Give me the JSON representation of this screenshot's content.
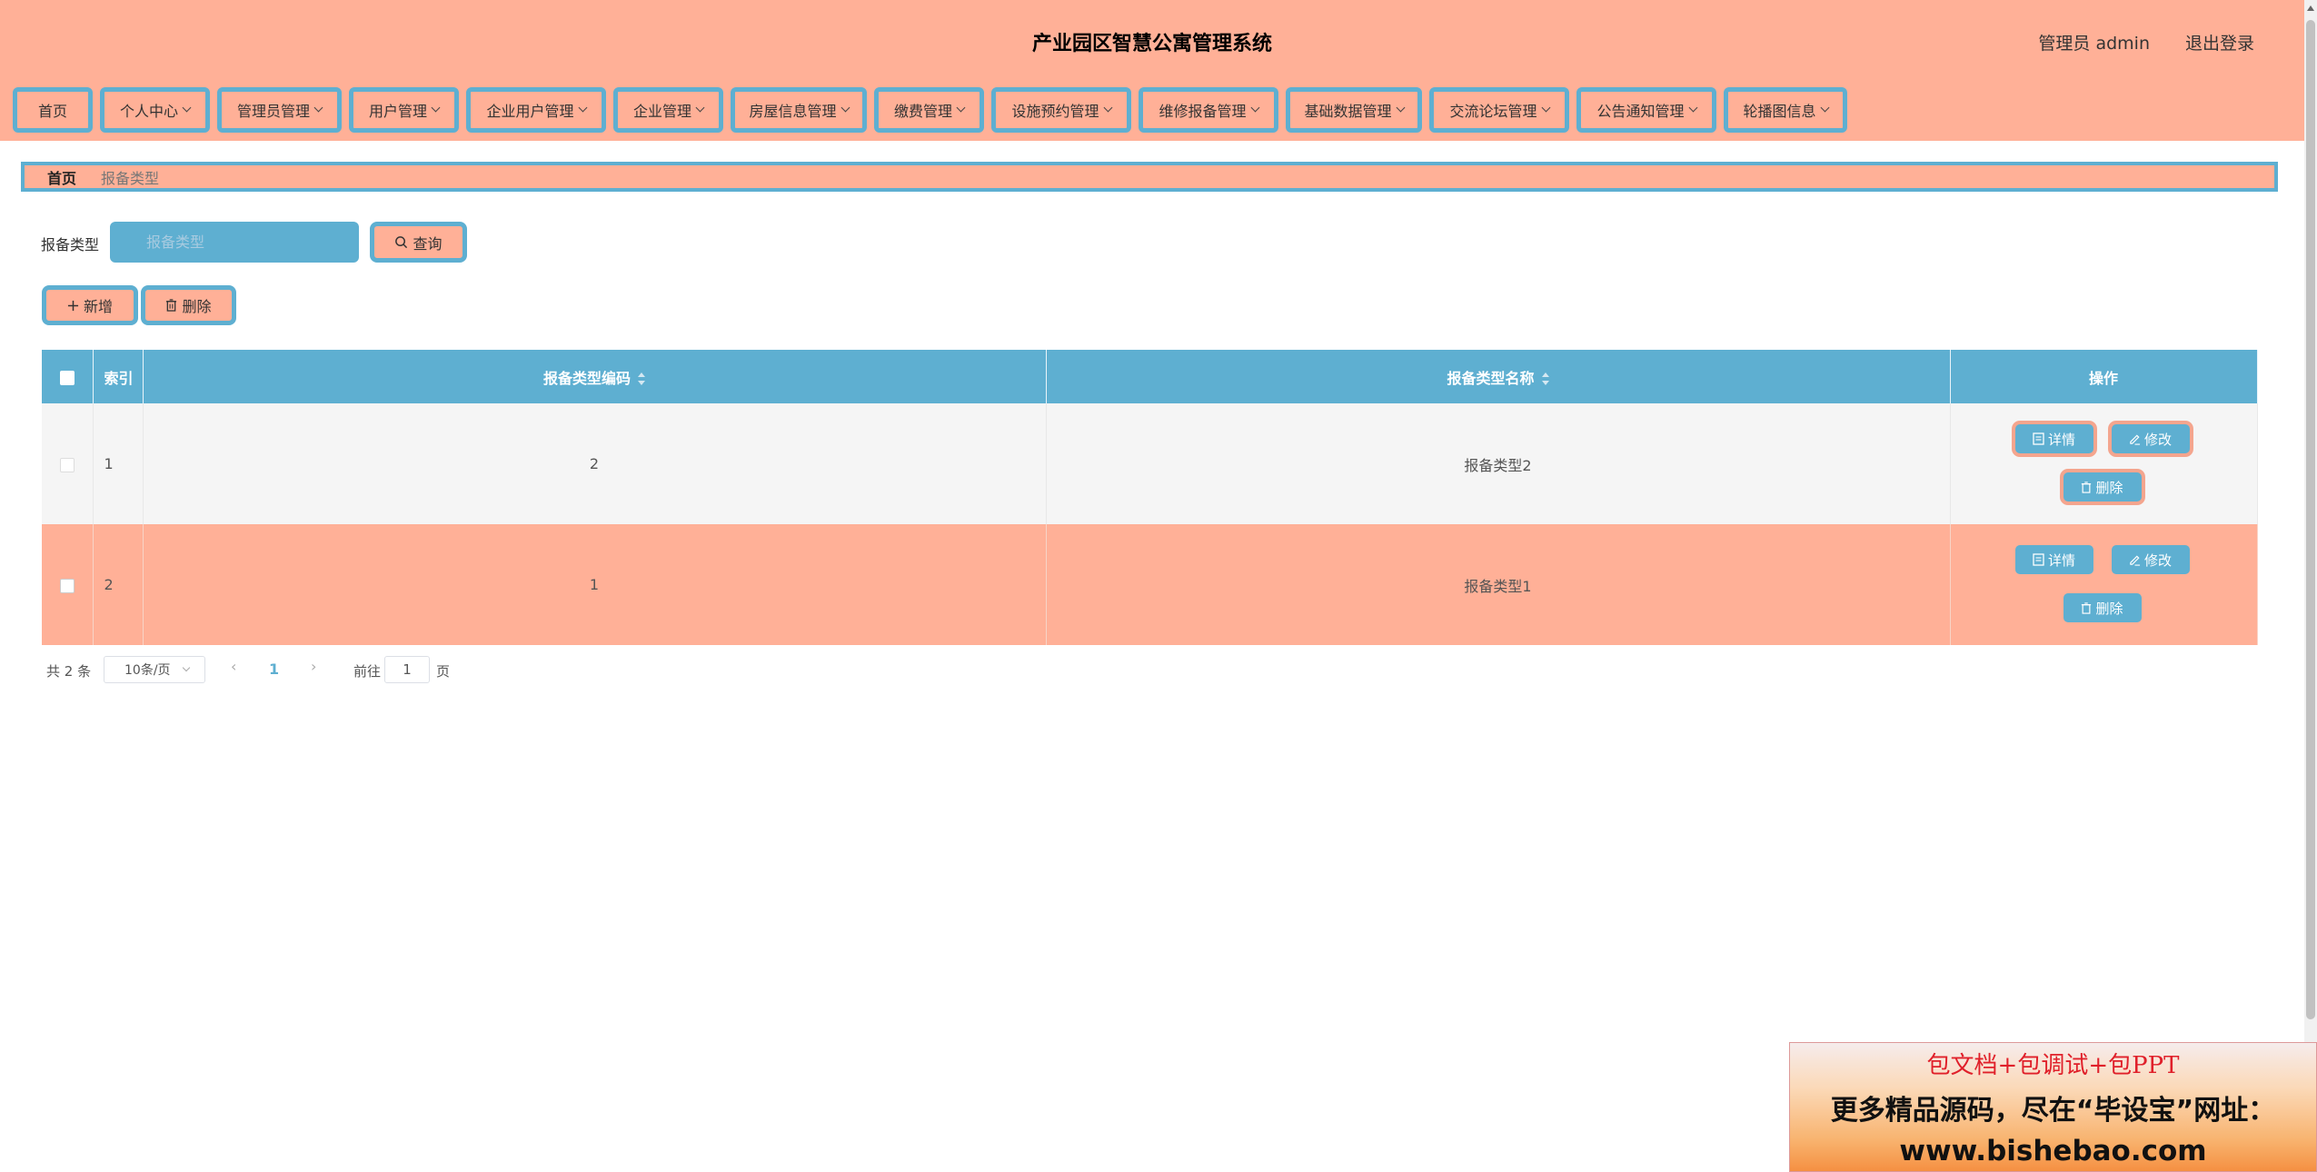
{
  "header": {
    "title": "产业园区智慧公寓管理系统",
    "user": "管理员 admin",
    "logout": "退出登录"
  },
  "nav": {
    "items": [
      {
        "label": "首页",
        "dropdown": false
      },
      {
        "label": "个人中心",
        "dropdown": true
      },
      {
        "label": "管理员管理",
        "dropdown": true
      },
      {
        "label": "用户管理",
        "dropdown": true
      },
      {
        "label": "企业用户管理",
        "dropdown": true
      },
      {
        "label": "企业管理",
        "dropdown": true
      },
      {
        "label": "房屋信息管理",
        "dropdown": true
      },
      {
        "label": "缴费管理",
        "dropdown": true
      },
      {
        "label": "设施预约管理",
        "dropdown": true
      },
      {
        "label": "维修报备管理",
        "dropdown": true
      },
      {
        "label": "基础数据管理",
        "dropdown": true
      },
      {
        "label": "交流论坛管理",
        "dropdown": true
      },
      {
        "label": "公告通知管理",
        "dropdown": true
      },
      {
        "label": "轮播图信息",
        "dropdown": true
      }
    ]
  },
  "breadcrumb": {
    "home": "首页",
    "current": "报备类型"
  },
  "search": {
    "label": "报备类型",
    "placeholder": "报备类型",
    "button": "查询"
  },
  "actions": {
    "add": "新增",
    "delete": "删除"
  },
  "table": {
    "headers": {
      "index": "索引",
      "code": "报备类型编码",
      "name": "报备类型名称",
      "ops": "操作"
    },
    "rows": [
      {
        "index": "1",
        "code": "2",
        "name": "报备类型2"
      },
      {
        "index": "2",
        "code": "1",
        "name": "报备类型1"
      }
    ],
    "row_ops": {
      "detail": "详情",
      "edit": "修改",
      "delete": "删除"
    }
  },
  "pagination": {
    "total": "共 2 条",
    "page_size": "10条/页",
    "current_page": "1",
    "goto_label": "前往",
    "goto_value": "1",
    "page_suffix": "页"
  },
  "ad": {
    "line1": "包文档+包调试+包PPT",
    "line2": "更多精品源码，尽在“毕设宝”网址：",
    "line3": "www.bishebao.com"
  },
  "colors": {
    "salmon": "#ffb097",
    "blue": "#5eafd1"
  },
  "icons": [
    "search-icon",
    "plus-icon",
    "trash-icon",
    "document-icon",
    "edit-icon",
    "chevron-down-icon",
    "chevron-left-icon",
    "chevron-right-icon",
    "sort-icon"
  ]
}
